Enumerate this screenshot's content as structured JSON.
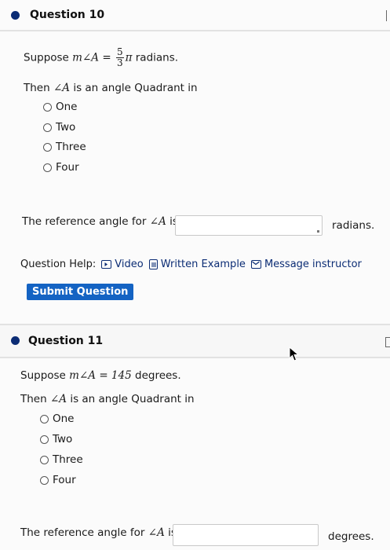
{
  "q10": {
    "title": "Question 10",
    "suppose_prefix": "Suppose",
    "math_lhs": "m∠A =",
    "frac_num": "5",
    "frac_den": "3",
    "pi": "π",
    "suppose_suffix": "radians.",
    "then_text_1": "Then",
    "then_angle": "∠A",
    "then_text_2": "is an angle Quadrant in",
    "options": [
      "One",
      "Two",
      "Three",
      "Four"
    ],
    "ref_prefix": "The reference angle for",
    "ref_angle": "∠A",
    "ref_is": "is",
    "ref_unit": "radians.",
    "help_label": "Question Help:",
    "help_video": "Video",
    "help_written": "Written Example",
    "help_message": "Message instructor",
    "submit": "Submit Question"
  },
  "q11": {
    "title": "Question 11",
    "suppose_prefix": "Suppose",
    "math_lhs": "m∠A = 145",
    "suppose_suffix": "degrees.",
    "then_text_1": "Then",
    "then_angle": "∠A",
    "then_text_2": "is an angle Quadrant in",
    "options": [
      "One",
      "Two",
      "Three",
      "Four"
    ],
    "ref_prefix": "The reference angle for",
    "ref_angle": "∠A",
    "ref_is": "is",
    "ref_unit": "degrees."
  },
  "colors": {
    "accent_dark": "#0b2c74",
    "submit_bg": "#1463c3"
  },
  "icons": {
    "video": "video-icon",
    "written": "document-icon",
    "message": "mail-icon"
  }
}
